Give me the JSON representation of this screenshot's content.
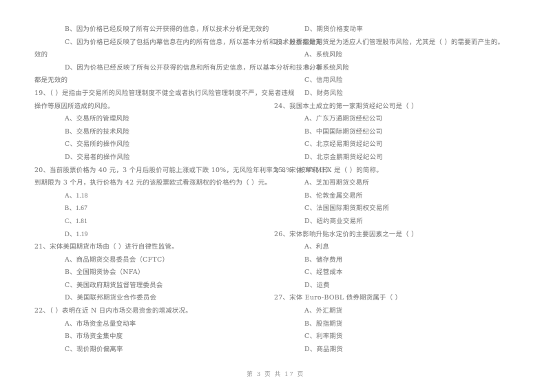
{
  "document": {
    "type": "scanned-exam-paper",
    "footer": "第 3 页 共 17 页",
    "page_number": "3",
    "total_pages": "17"
  },
  "left_column": {
    "lines": [
      {
        "id": "l1",
        "kind": "option",
        "text": "B、因为价格已经反映了所有公开获得的信息，所以技术分析是无效的"
      },
      {
        "id": "l2",
        "kind": "option",
        "text": "C、因为价格已经反映了包括内幕信息在内的所有信息，所以基本分析和技术分析都是无"
      },
      {
        "id": "l3",
        "kind": "option-wrap",
        "text": "效的"
      },
      {
        "id": "l4",
        "kind": "option",
        "text": "D、因为价格已经反映了所有公开获得的信息和所有历史信息，所以基本分析和技术分析"
      },
      {
        "id": "l5",
        "kind": "option-wrap",
        "text": "都是无效的"
      },
      {
        "id": "l6",
        "kind": "stem",
        "text": "19、（       ）是指由于交易所的风险管理制度不健全或者执行风险管理制度不严，交易者违规"
      },
      {
        "id": "l7",
        "kind": "stem-wrap",
        "text": "操作等原因所造成的风险。"
      },
      {
        "id": "l8",
        "kind": "option",
        "text": "A、交易所的管理风险"
      },
      {
        "id": "l9",
        "kind": "option",
        "text": "B、交易所的技术风险"
      },
      {
        "id": "l10",
        "kind": "option",
        "text": "C、交易所的操作风险"
      },
      {
        "id": "l11",
        "kind": "option",
        "text": "D、交易者的操作风险"
      },
      {
        "id": "l12",
        "kind": "stem",
        "text": "20、当前股票价格为 40 元，3 个月后股价可能上涨或下跌 10%，无风险年利率为 8%（按单利计）"
      },
      {
        "id": "l13",
        "kind": "stem-wrap",
        "text": "到期限为 3 个月，执行价格为 42 元的该股票欧式看涨期权的价格约为（        ）元。"
      },
      {
        "id": "l14",
        "kind": "option",
        "text": "A、1.18"
      },
      {
        "id": "l15",
        "kind": "option",
        "text": "B、1.67"
      },
      {
        "id": "l16",
        "kind": "option",
        "text": "C、1.81"
      },
      {
        "id": "l17",
        "kind": "option",
        "text": "D、1.19"
      },
      {
        "id": "l18",
        "kind": "stem",
        "text": "21、宋体美国期货市场由（      ）进行自律性监管。"
      },
      {
        "id": "l19",
        "kind": "option",
        "text": "A、商品期货交易委员会（CFTC）"
      },
      {
        "id": "l20",
        "kind": "option",
        "text": "B、全国期货协会（NFA）"
      },
      {
        "id": "l21",
        "kind": "option",
        "text": "C、美国政府期货监督管理委员会"
      },
      {
        "id": "l22",
        "kind": "option",
        "text": "D、美国联邦期货业合作委员会"
      },
      {
        "id": "l23",
        "kind": "stem",
        "text": "22、（       ）表明在近 N 日内市场交易资金的增减状况。"
      },
      {
        "id": "l24",
        "kind": "option",
        "text": "A、市场资金总量变动率"
      },
      {
        "id": "l25",
        "kind": "option",
        "text": "B、市场资金集中度"
      },
      {
        "id": "l26",
        "kind": "option",
        "text": "C、现价期价偏离率"
      }
    ]
  },
  "right_column": {
    "lines": [
      {
        "id": "r1",
        "kind": "option",
        "text": "D、期货价格变动率"
      },
      {
        "id": "r2",
        "kind": "stem",
        "text": "23、股票指数期货是为适应人们管理股市风险，尤其是（      ）的需要而产生的。"
      },
      {
        "id": "r3",
        "kind": "option",
        "text": "A、系统风险"
      },
      {
        "id": "r4",
        "kind": "option",
        "text": "B、非系统风险"
      },
      {
        "id": "r5",
        "kind": "option",
        "text": "C、信用风险"
      },
      {
        "id": "r6",
        "kind": "option",
        "text": "D、财务风险"
      },
      {
        "id": "r7",
        "kind": "stem",
        "text": "24、我国本土成立的第一家期货经纪公司是（      ）"
      },
      {
        "id": "r8",
        "kind": "option",
        "text": "A、广东万通期货经纪公司"
      },
      {
        "id": "r9",
        "kind": "option",
        "text": "B、中国国际期货经纪公司"
      },
      {
        "id": "r10",
        "kind": "option",
        "text": "C、北京经易期货经纪公司"
      },
      {
        "id": "r11",
        "kind": "option",
        "text": "D、北京金鹏期货经纪公司"
      },
      {
        "id": "r12",
        "kind": "stem",
        "text": "25、宋体 NYMEX 是（      ）的简称。"
      },
      {
        "id": "r13",
        "kind": "option",
        "text": "A、芝加哥期货交易所"
      },
      {
        "id": "r14",
        "kind": "option",
        "text": "B、伦敦金属交易所"
      },
      {
        "id": "r15",
        "kind": "option",
        "text": "C、法国国际期货期权交易所"
      },
      {
        "id": "r16",
        "kind": "option",
        "text": "D、纽约商业交易所"
      },
      {
        "id": "r17",
        "kind": "stem",
        "text": "26、宋体影响升贴水定价的主要因素之一是（      ）"
      },
      {
        "id": "r18",
        "kind": "option",
        "text": "A、利息"
      },
      {
        "id": "r19",
        "kind": "option",
        "text": "B、储存费用"
      },
      {
        "id": "r20",
        "kind": "option",
        "text": "C、经营成本"
      },
      {
        "id": "r21",
        "kind": "option",
        "text": "D、运费"
      },
      {
        "id": "r22",
        "kind": "stem",
        "text": "27、宋体 Euro-BOBL 债券期货属于（      ）"
      },
      {
        "id": "r23",
        "kind": "option",
        "text": "A、外汇期货"
      },
      {
        "id": "r24",
        "kind": "option",
        "text": "B、股指期货"
      },
      {
        "id": "r25",
        "kind": "option",
        "text": "C、利率期货"
      },
      {
        "id": "r26",
        "kind": "option",
        "text": "D、商品期货"
      }
    ]
  }
}
